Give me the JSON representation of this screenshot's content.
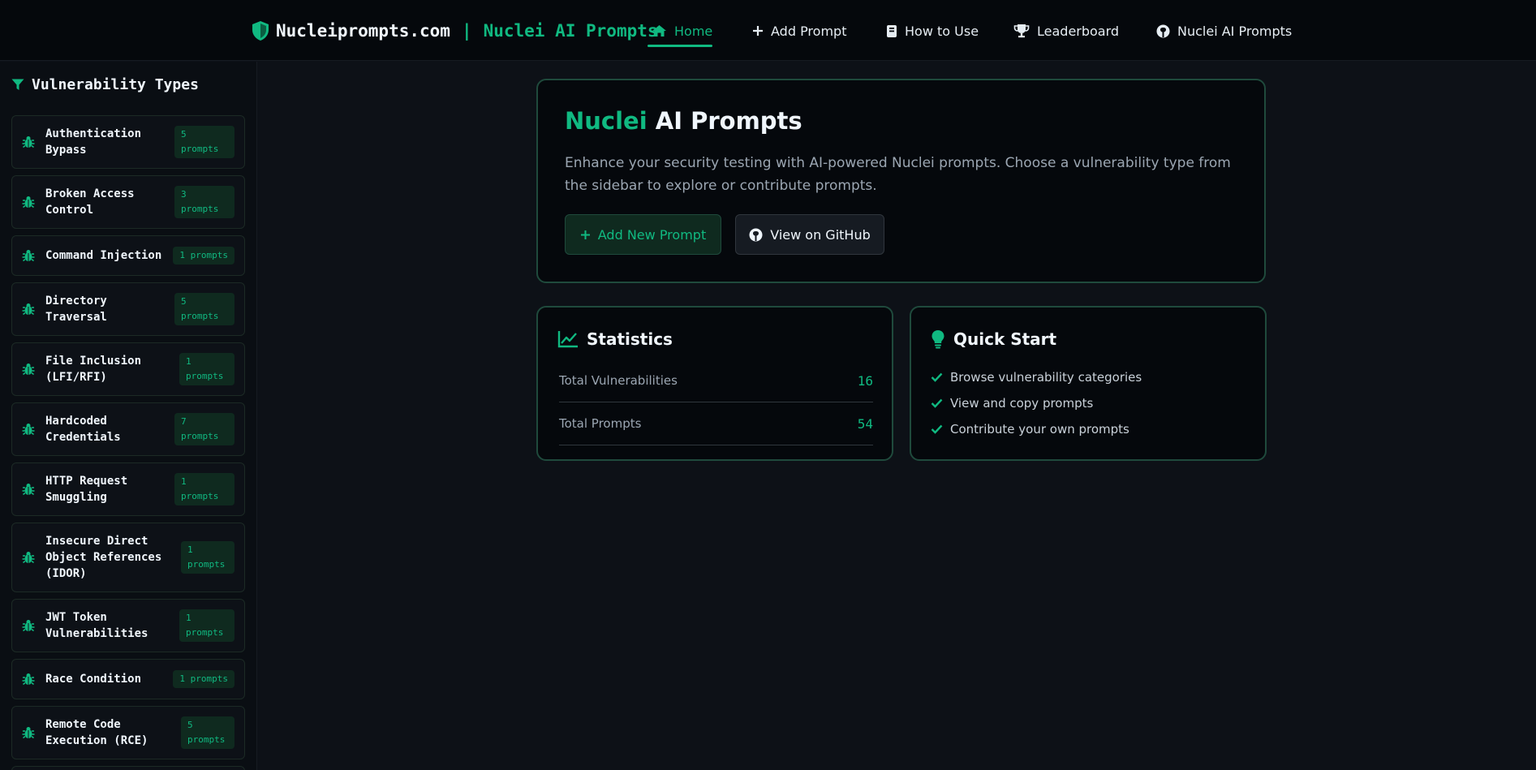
{
  "brand": {
    "name": "Nucleiprompts.com",
    "separator": "|",
    "subtitle": "Nuclei AI Prompts"
  },
  "nav": {
    "home": "Home",
    "add_prompt": "Add Prompt",
    "how_to_use": "How to Use",
    "leaderboard": "Leaderboard",
    "github": "Nuclei AI Prompts"
  },
  "sidebar": {
    "title": "Vulnerability Types",
    "items": [
      {
        "label": "Authentication Bypass",
        "count": "5 prompts"
      },
      {
        "label": "Broken Access Control",
        "count": "3 prompts"
      },
      {
        "label": "Command Injection",
        "count": "1 prompts"
      },
      {
        "label": "Directory Traversal",
        "count": "5 prompts"
      },
      {
        "label": "File Inclusion (LFI/RFI)",
        "count": "1 prompts"
      },
      {
        "label": "Hardcoded Credentials",
        "count": "7 prompts"
      },
      {
        "label": "HTTP Request Smuggling",
        "count": "1 prompts"
      },
      {
        "label": "Insecure Direct Object References (IDOR)",
        "count": "1 prompts"
      },
      {
        "label": "JWT Token Vulnerabilities",
        "count": "1 prompts"
      },
      {
        "label": "Race Condition",
        "count": "1 prompts"
      },
      {
        "label": "Remote Code Execution (RCE)",
        "count": "5 prompts"
      }
    ]
  },
  "hero": {
    "title_accent": "Nuclei",
    "title_rest": "AI Prompts",
    "description": "Enhance your security testing with AI-powered Nuclei prompts. Choose a vulnerability type from the sidebar to explore or contribute prompts.",
    "add_button": "Add New Prompt",
    "github_button": "View on GitHub"
  },
  "stats": {
    "title": "Statistics",
    "rows": [
      {
        "label": "Total Vulnerabilities",
        "value": "16"
      },
      {
        "label": "Total Prompts",
        "value": "54"
      }
    ]
  },
  "quick_start": {
    "title": "Quick Start",
    "items": [
      "Browse vulnerability categories",
      "View and copy prompts",
      "Contribute your own prompts"
    ]
  },
  "colors": {
    "accent": "#10b981",
    "background": "#0d1117",
    "card_border": "#1f4a3c"
  }
}
